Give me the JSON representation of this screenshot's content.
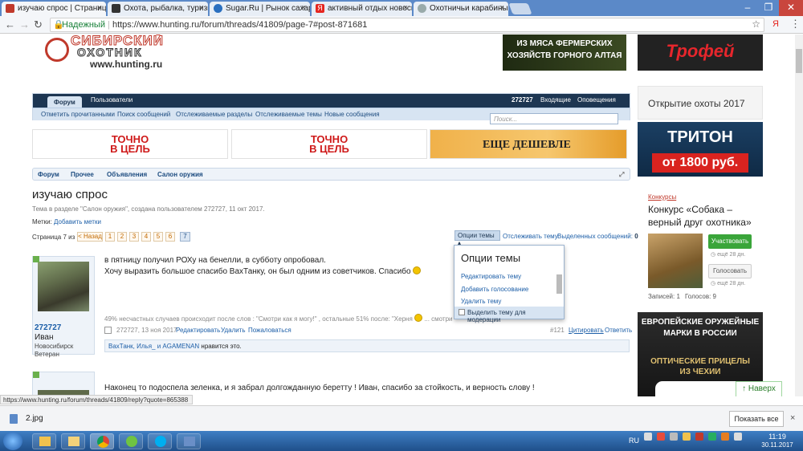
{
  "browser": {
    "tabs": [
      {
        "title": "изучаю спрос | Страница",
        "active": true
      },
      {
        "title": "Охота, рыбалка, туризм",
        "active": false
      },
      {
        "title": "Sugar.Ru | Рынок сахара",
        "active": false
      },
      {
        "title": "активный отдых новосиб",
        "active": false
      },
      {
        "title": "Охотничьи карабины В",
        "active": false
      }
    ],
    "security_label": "Надежный",
    "url": "https://www.hunting.ru/forum/threads/41809/page-7#post-871681"
  },
  "site": {
    "logo_line1": "СИБИРСКИЙ",
    "logo_line2": "ОХОТНИК",
    "logo_url": "www.hunting.ru",
    "top_banner1_line1": "ИЗ МЯСА ФЕРМЕРСКИХ",
    "top_banner1_line2": "ХОЗЯЙСТВ ГОРНОГО АЛТАЯ",
    "top_banner2": "Трофей"
  },
  "nav": {
    "tabs": [
      "Форум",
      "Пользователи"
    ],
    "user_links": [
      "272727",
      "Входящие",
      "Оповещения"
    ],
    "sub_links": [
      "Отметить прочитанными",
      "Поиск сообщений",
      "Отслеживаемые разделы",
      "Отслеживаемые темы",
      "Новые сообщения"
    ],
    "search_placeholder": "Поиск..."
  },
  "ads": {
    "ad1_line1": "ТОЧНО",
    "ad1_line2": "В ЦЕЛЬ",
    "ad2_line1": "ТОЧНО",
    "ad2_line2": "В ЦЕЛЬ",
    "ad3": "ЕЩЕ ДЕШЕВЛЕ"
  },
  "breadcrumbs": [
    "Форум",
    "Прочее",
    "Объявления",
    "Салон оружия"
  ],
  "thread": {
    "title": "изучаю спрос",
    "subtitle": "Тема в разделе \"Салон оружия\", создана пользователем 272727, 11 окт 2017.",
    "tags_label": "Метки:",
    "tags_link": "Добавить метки",
    "page_label": "Страница 7 из 7",
    "prev_label": "< Назад",
    "pages": [
      "1",
      "2",
      "3",
      "4",
      "5",
      "6",
      "7"
    ],
    "options_label": "Опции темы",
    "watch_label": "Отслеживать тему",
    "selected_label": "Выделенных сообщений:",
    "selected_count": "0"
  },
  "options_menu": {
    "header": "Опции темы",
    "items": [
      "Редактировать тему",
      "Добавить голосование",
      "Удалить тему"
    ],
    "footer": "Выделить тему для модерации"
  },
  "post1": {
    "username": "272727",
    "realname": "Иван",
    "city": "Новосибирск",
    "rank": "Ветеран",
    "line1": "в пятницу получил РОХу на бенелли, в субботу опробовал.",
    "line2": "Хочу выразить большое спасибо ВахТанку, он был одним из советчиков. Спасибо",
    "signature": "49% несчастных случаев происходит после слов : \"Смотри как я могу!\" , остальные 51% после: \"Херня",
    "signature_end": "... смотри как",
    "meta": "272727, 13 ноя 2017",
    "actions": [
      "Редактировать",
      "Удалить",
      "Пожаловаться"
    ],
    "post_number": "#121",
    "quote": "Цитировать",
    "reply": "Ответить",
    "likers": "ВахТанк, Илья_ и AGAMENAN",
    "likes_suffix": " нравится это."
  },
  "post2": {
    "line1": "Наконец то подоспела зеленка, и я забрал долгожданную беретту ! Иван, спасибо за стойкость, и верность слову !"
  },
  "sidebar": {
    "opening": "Открытие охоты 2017",
    "triton_title": "ТРИТОН",
    "triton_price": "от 1800 руб.",
    "contests_label": "Конкурсы",
    "contest_title": "Конкурс «Собака – верный друг охотника»",
    "participate": "Участвовать",
    "participate_time": "ещё 28 дн.",
    "vote": "Голосовать",
    "vote_time": "ещё 28 дн.",
    "entries": "Записей: 1",
    "votes": "Голосов: 9",
    "euro_line1": "ЕВРОПЕЙСКИЕ ОРУЖЕЙНЫЕ",
    "euro_line2": "МАРКИ В РОССИИ",
    "euro_line3": "ОПТИЧЕСКИЕ ПРИЦЕЛЫ",
    "euro_line4": "ИЗ ЧЕХИИ"
  },
  "back_to_top": "↑ Наверх",
  "status_url": "https://www.hunting.ru/forum/threads/41809/reply?quote=865388",
  "download": {
    "file": "2.jpg",
    "show_all": "Показать все"
  },
  "taskbar": {
    "lang": "RU",
    "time": "11:19",
    "date": "30.11.2017"
  },
  "colors": {
    "nav_dark": "#1d3652",
    "nav_light": "#d7e4f2",
    "link": "#1d5fa8",
    "accent_green": "#3aa53a",
    "ad_red": "#cf1a1a"
  }
}
